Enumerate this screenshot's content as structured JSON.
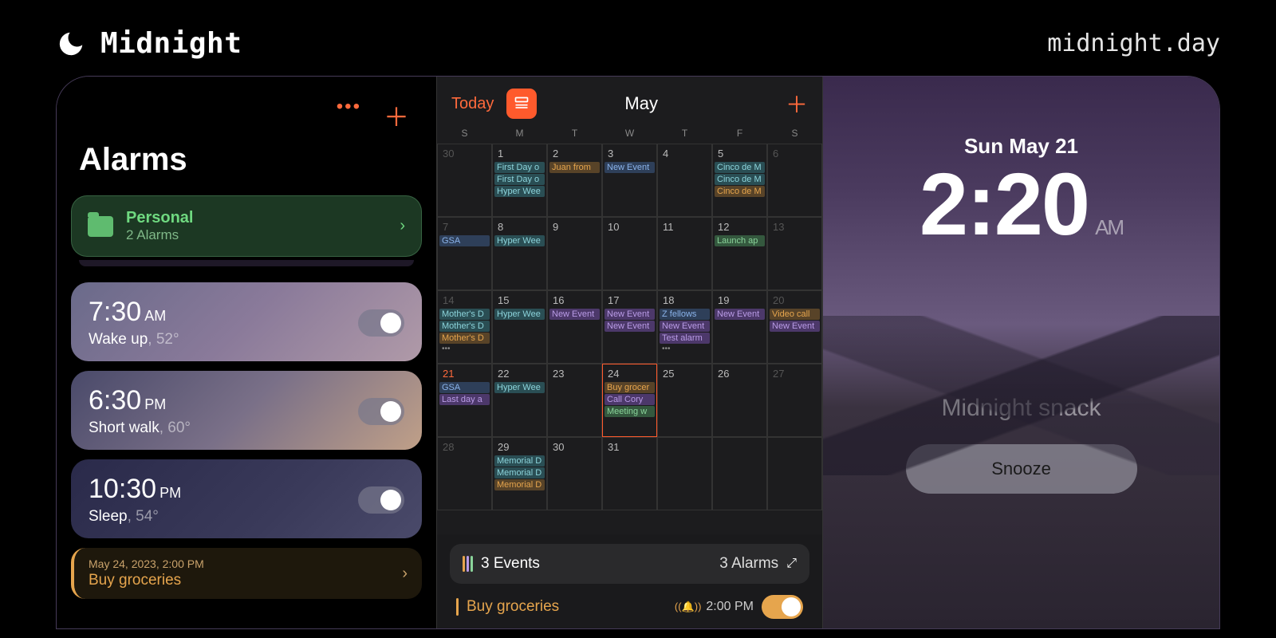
{
  "header": {
    "brand": "Midnight",
    "url": "midnight.day"
  },
  "alarms_pane": {
    "title": "Alarms",
    "folder": {
      "name": "Personal",
      "sub": "2 Alarms"
    },
    "alarms": [
      {
        "time": "7:30",
        "ampm": "AM",
        "label": "Wake up",
        "temp": ", 52°"
      },
      {
        "time": "6:30",
        "ampm": "PM",
        "label": "Short walk",
        "temp": ", 60°"
      },
      {
        "time": "10:30",
        "ampm": "PM",
        "label": "Sleep",
        "temp": ", 54°"
      }
    ],
    "reminder": {
      "date": "May 24, 2023, 2:00 PM",
      "title": "Buy groceries"
    }
  },
  "calendar": {
    "today_label": "Today",
    "month": "May",
    "dow": [
      "S",
      "M",
      "T",
      "W",
      "T",
      "F",
      "S"
    ],
    "summary": {
      "events": "3 Events",
      "alarms": "3 Alarms"
    },
    "task": {
      "name": "Buy groceries",
      "time": "2:00 PM"
    },
    "cells": [
      {
        "n": "30",
        "dim": true,
        "ev": []
      },
      {
        "n": "1",
        "ev": [
          {
            "t": "First Day o",
            "c": "teal"
          },
          {
            "t": "First Day o",
            "c": "teal"
          },
          {
            "t": "Hyper Wee",
            "c": "teal"
          }
        ]
      },
      {
        "n": "2",
        "ev": [
          {
            "t": "Juan from",
            "c": "orange"
          }
        ]
      },
      {
        "n": "3",
        "ev": [
          {
            "t": "New Event",
            "c": "blue"
          }
        ]
      },
      {
        "n": "4",
        "ev": []
      },
      {
        "n": "5",
        "ev": [
          {
            "t": "Cinco de M",
            "c": "teal"
          },
          {
            "t": "Cinco de M",
            "c": "teal"
          },
          {
            "t": "Cinco de M",
            "c": "orange"
          }
        ]
      },
      {
        "n": "6",
        "dim": true,
        "ev": []
      },
      {
        "n": "7",
        "dim": true,
        "ev": [
          {
            "t": "GSA",
            "c": "blue"
          }
        ]
      },
      {
        "n": "8",
        "ev": [
          {
            "t": "Hyper Wee",
            "c": "teal"
          }
        ]
      },
      {
        "n": "9",
        "ev": []
      },
      {
        "n": "10",
        "ev": []
      },
      {
        "n": "11",
        "ev": []
      },
      {
        "n": "12",
        "ev": [
          {
            "t": "Launch ap",
            "c": "green"
          }
        ]
      },
      {
        "n": "13",
        "dim": true,
        "ev": []
      },
      {
        "n": "14",
        "dim": true,
        "ev": [
          {
            "t": "Mother's D",
            "c": "teal"
          },
          {
            "t": "Mother's D",
            "c": "teal"
          },
          {
            "t": "Mother's D",
            "c": "orange"
          }
        ],
        "more": true
      },
      {
        "n": "15",
        "ev": [
          {
            "t": "Hyper Wee",
            "c": "teal"
          }
        ]
      },
      {
        "n": "16",
        "ev": [
          {
            "t": "New Event",
            "c": "purple"
          }
        ]
      },
      {
        "n": "17",
        "ev": [
          {
            "t": "New Event",
            "c": "purple"
          },
          {
            "t": "New Event",
            "c": "purple"
          }
        ]
      },
      {
        "n": "18",
        "ev": [
          {
            "t": "Z fellows",
            "c": "blue"
          },
          {
            "t": "New Event",
            "c": "purple"
          },
          {
            "t": "Test alarm",
            "c": "purple"
          }
        ],
        "more": true
      },
      {
        "n": "19",
        "ev": [
          {
            "t": "New Event",
            "c": "purple"
          }
        ]
      },
      {
        "n": "20",
        "dim": true,
        "ev": [
          {
            "t": "Video call",
            "c": "orange"
          },
          {
            "t": "New Event",
            "c": "purple"
          }
        ]
      },
      {
        "n": "21",
        "sel": true,
        "ev": [
          {
            "t": "GSA",
            "c": "blue"
          },
          {
            "t": "Last day a",
            "c": "purple"
          }
        ]
      },
      {
        "n": "22",
        "ev": [
          {
            "t": "Hyper Wee",
            "c": "teal"
          }
        ]
      },
      {
        "n": "23",
        "ev": []
      },
      {
        "n": "24",
        "selbox": true,
        "ev": [
          {
            "t": "Buy grocer",
            "c": "orange"
          },
          {
            "t": "Call Cory",
            "c": "purple"
          },
          {
            "t": "Meeting w",
            "c": "green"
          }
        ]
      },
      {
        "n": "25",
        "ev": []
      },
      {
        "n": "26",
        "ev": []
      },
      {
        "n": "27",
        "dim": true,
        "ev": []
      },
      {
        "n": "28",
        "dim": true,
        "ev": []
      },
      {
        "n": "29",
        "ev": [
          {
            "t": "Memorial D",
            "c": "teal"
          },
          {
            "t": "Memorial D",
            "c": "teal"
          },
          {
            "t": "Memorial D",
            "c": "orange"
          }
        ]
      },
      {
        "n": "30",
        "ev": []
      },
      {
        "n": "31",
        "ev": []
      },
      {
        "n": "",
        "ev": []
      },
      {
        "n": "",
        "ev": []
      },
      {
        "n": "",
        "ev": []
      }
    ]
  },
  "lock": {
    "date": "Sun May 21",
    "time": "2:20",
    "ampm": "AM",
    "alarm_name": "Midnight snack",
    "snooze": "Snooze"
  }
}
